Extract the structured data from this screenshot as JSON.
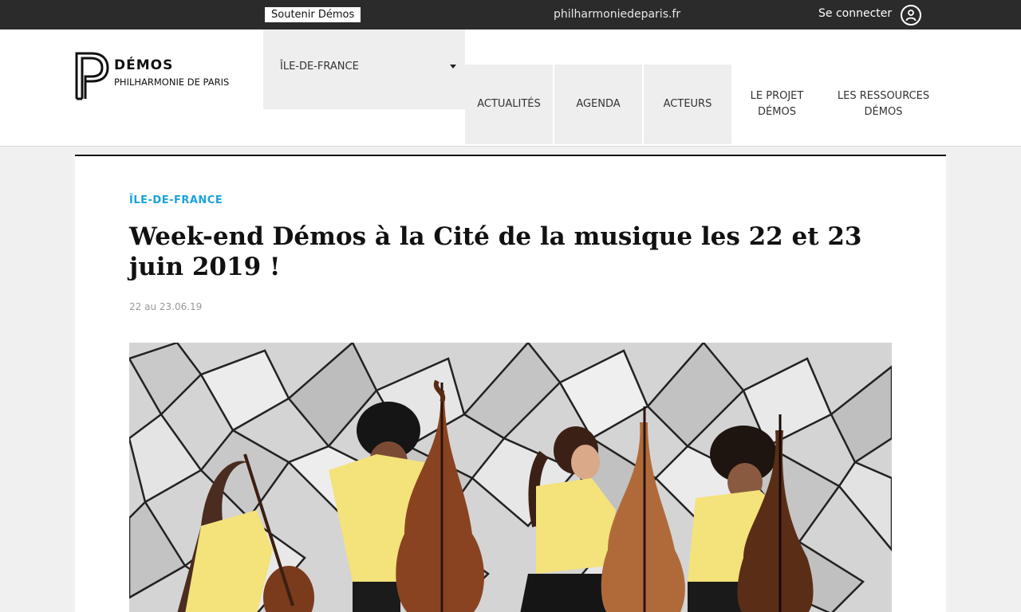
{
  "topbar": {
    "support_label": "Soutenir Démos",
    "site_link": "philharmoniedeparis.fr",
    "login_label": "Se connecter",
    "login_icon": "user-circle-icon"
  },
  "header": {
    "logo": {
      "name": "DÉMOS",
      "sub": "PHILHARMONIE DE PARIS"
    },
    "region": {
      "selected": "ÎLE-DE-FRANCE"
    },
    "nav": {
      "actualites": "ACTUALITÉS",
      "agenda": "AGENDA",
      "acteurs": "ACTEURS",
      "projet_line1": "LE PROJET",
      "projet_line2": "DÉMOS",
      "ressources_line1": "LES RESSOURCES",
      "ressources_line2": "DÉMOS"
    }
  },
  "article": {
    "category": "ÎLE-DE-FRANCE",
    "title": "Week-end Démos à la Cité de la musique les 22 et 23 juin 2019 !",
    "date": "22 au 23.06.19"
  },
  "colors": {
    "topbar_bg": "#2b2b2b",
    "accent": "#1aa3dc",
    "nav_bg": "#eeeeee",
    "shirt": "#f4e27a"
  }
}
